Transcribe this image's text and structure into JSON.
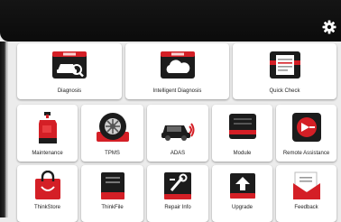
{
  "header": {
    "settings_icon": "gear-icon"
  },
  "colors": {
    "accent": "#d41f26",
    "header_bg": "#111111",
    "tile_bg": "#ffffff",
    "page_bg": "#ececec"
  },
  "tiles": {
    "diagnosis": {
      "label": "Diagnosis",
      "icon": "car-search-icon"
    },
    "intelligent_diagnosis": {
      "label": "Intelligent Diagnosis",
      "icon": "cloud-icon"
    },
    "quick_check": {
      "label": "Quick Check",
      "icon": "report-icon"
    },
    "maintenance": {
      "label": "Maintenance",
      "icon": "oil-can-icon"
    },
    "tpms": {
      "label": "TPMS",
      "icon": "tire-icon"
    },
    "adas": {
      "label": "ADAS",
      "icon": "adas-car-icon"
    },
    "module": {
      "label": "Module",
      "icon": "module-icon"
    },
    "remote_assistance": {
      "label": "Remote Assistance",
      "icon": "remote-assist-icon"
    },
    "thinkstore": {
      "label": "ThinkStore",
      "icon": "shopping-bag-icon"
    },
    "thinkfile": {
      "label": "ThinkFile",
      "icon": "file-icon"
    },
    "repair_info": {
      "label": "Repair Info",
      "icon": "repair-info-icon"
    },
    "upgrade": {
      "label": "Upgrade",
      "icon": "upgrade-icon"
    },
    "feedback": {
      "label": "Feedback",
      "icon": "feedback-icon"
    }
  }
}
